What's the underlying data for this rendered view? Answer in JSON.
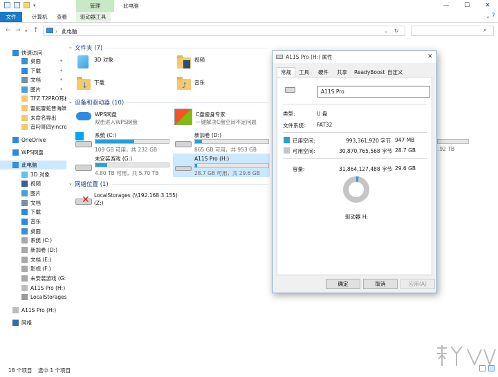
{
  "window": {
    "ribbon_context_tab": "管理",
    "title": "此电脑",
    "controls": [
      "—",
      "☐",
      "✕"
    ]
  },
  "ribbon": {
    "tabs": [
      "文件",
      "计算机",
      "查看",
      "驱动器工具"
    ]
  },
  "address": {
    "path": "此电脑",
    "back": "←",
    "forward": "→",
    "up": "↑",
    "refresh": "↻"
  },
  "nav": {
    "items": [
      {
        "label": "快速访问",
        "icon": "star-icon"
      },
      {
        "label": "桌面",
        "icon": "desktop-icon"
      },
      {
        "label": "下载",
        "icon": "download-icon"
      },
      {
        "label": "文档",
        "icon": "document-icon"
      },
      {
        "label": "图片",
        "icon": "picture-icon"
      },
      {
        "label": "TFZ T2PRO耳机",
        "icon": "folder-icon"
      },
      {
        "label": "雷蛇雷蛇晋海妖V",
        "icon": "folder-icon"
      },
      {
        "label": "未命名导出",
        "icon": "folder-icon"
      },
      {
        "label": "音叼哥四yincrow天",
        "icon": "folder-icon"
      },
      {
        "label": "OneDrive",
        "icon": "cloud-icon"
      },
      {
        "label": "WPS网盘",
        "icon": "cloud-icon"
      },
      {
        "label": "此电脑",
        "icon": "computer-icon"
      },
      {
        "label": "3D 对象",
        "icon": "3d-objects-icon"
      },
      {
        "label": "视频",
        "icon": "video-icon"
      },
      {
        "label": "图片",
        "icon": "picture-icon"
      },
      {
        "label": "文档",
        "icon": "document-icon"
      },
      {
        "label": "下载",
        "icon": "download-icon"
      },
      {
        "label": "音乐",
        "icon": "music-icon"
      },
      {
        "label": "桌面",
        "icon": "desktop-icon"
      },
      {
        "label": "系统 (C:)",
        "icon": "drive-icon"
      },
      {
        "label": "新加卷 (D:)",
        "icon": "drive-icon"
      },
      {
        "label": "文档 (E:)",
        "icon": "drive-icon"
      },
      {
        "label": "影视 (F:)",
        "icon": "drive-icon"
      },
      {
        "label": "未安装游戏 (G:)",
        "icon": "drive-icon"
      },
      {
        "label": "A11S Pro (H:)",
        "icon": "usb-drive-icon"
      },
      {
        "label": "LocalStorages (\\\\",
        "icon": "network-drive-icon"
      },
      {
        "label": "A11S Pro (H:)",
        "icon": "usb-drive-icon"
      },
      {
        "label": "网络",
        "icon": "network-icon"
      }
    ]
  },
  "content": {
    "folders_header": "文件夹 (7)",
    "folders": [
      "3D 对象",
      "视频",
      "下载",
      "音乐"
    ],
    "devices_header": "设备和驱动器 (10)",
    "wps": {
      "name": "WPS网盘",
      "desc": "双击进入WPS网盘"
    },
    "cclean": {
      "name": "C盘瘦身专家",
      "desc": "一键解决C盘空间不足问题"
    },
    "drives": [
      {
        "name": "系统 (C:)",
        "free": "109 GB 可用，共 232 GB",
        "used_fraction": 0.53
      },
      {
        "name": "新加卷 (D:)",
        "free": "865 GB 可用，共 953 GB",
        "used_fraction": 0.09
      },
      {
        "name": "未安装游戏 (G:)",
        "free": "4.80 TB 可用，共 5.70 TB",
        "used_fraction": 0.16
      },
      {
        "name": "A11S Pro (H:)",
        "free": "28.7 GB 可用，共 29.6 GB",
        "used_fraction": 0.03
      }
    ],
    "hidden_partial": ".92 TB",
    "network_header": "网络位置 (1)",
    "network": {
      "name": "LocalStorages (\\\\192.168.3.155)",
      "drive": "(Z:)"
    }
  },
  "status": {
    "count": "18 个项目",
    "selected": "选中 1 个项目"
  },
  "dialog": {
    "title": "A11S Pro (H:) 属性",
    "tabs": [
      "常规",
      "工具",
      "硬件",
      "共享",
      "ReadyBoost",
      "自定义"
    ],
    "name_value": "A11S Pro",
    "type_label": "类型:",
    "type_value": "U 盘",
    "fs_label": "文件系统:",
    "fs_value": "FAT32",
    "used_label": "已用空间:",
    "used_bytes": "993,361,920 字节",
    "used_size": "947 MB",
    "free_label": "可用空间:",
    "free_bytes": "30,870,765,568 字节",
    "free_size": "28.7 GB",
    "cap_label": "容量:",
    "cap_bytes": "31,864,127,488 字节",
    "cap_size": "29.6 GB",
    "used_fraction": 0.031,
    "drive_label": "驱动器 H:",
    "ok": "确定",
    "cancel": "取消",
    "apply": "应用(A)",
    "used_color": "#26a0da",
    "free_color": "#c5c5c5"
  }
}
